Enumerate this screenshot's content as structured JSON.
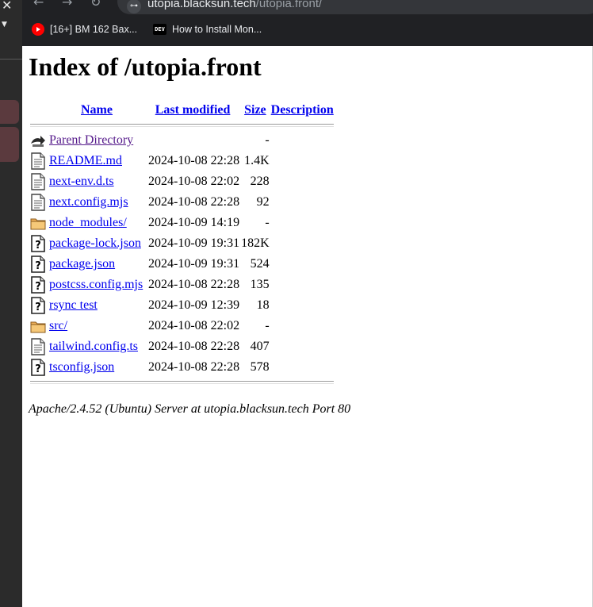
{
  "sidebar": {
    "close_glyph": "✕",
    "caret_glyph": "▼"
  },
  "browser": {
    "back_glyph": "←",
    "forward_glyph": "→",
    "reload_glyph": "↻",
    "site_info_glyph": "⊶",
    "url_host": "utopia.blacksun.tech",
    "url_path": "/utopia.front/",
    "bookmarks": [
      {
        "label": "[16+] BM 162 Bax...",
        "icon": "youtube-icon"
      },
      {
        "label": "How to Install Mon...",
        "icon": "dev-icon",
        "icon_text": "DEV"
      }
    ]
  },
  "page": {
    "title": "Index of /utopia.front",
    "columns": {
      "name": "Name",
      "last_modified": "Last modified",
      "size": "Size",
      "description": "Description"
    },
    "rows": [
      {
        "name": "Parent Directory",
        "modified": "",
        "size": "-",
        "icon": "back-icon"
      },
      {
        "name": "README.md",
        "modified": "2024-10-08 22:28",
        "size": "1.4K",
        "icon": "text-file-icon"
      },
      {
        "name": "next-env.d.ts",
        "modified": "2024-10-08 22:02",
        "size": "228",
        "icon": "text-file-icon"
      },
      {
        "name": "next.config.mjs",
        "modified": "2024-10-08 22:28",
        "size": "92",
        "icon": "text-file-icon"
      },
      {
        "name": "node_modules/",
        "modified": "2024-10-09 14:19",
        "size": "-",
        "icon": "folder-icon"
      },
      {
        "name": "package-lock.json",
        "modified": "2024-10-09 19:31",
        "size": "182K",
        "icon": "unknown-file-icon"
      },
      {
        "name": "package.json",
        "modified": "2024-10-09 19:31",
        "size": "524",
        "icon": "unknown-file-icon"
      },
      {
        "name": "postcss.config.mjs",
        "modified": "2024-10-08 22:28",
        "size": "135",
        "icon": "unknown-file-icon"
      },
      {
        "name": "rsync test",
        "modified": "2024-10-09 12:39",
        "size": "18",
        "icon": "unknown-file-icon"
      },
      {
        "name": "src/",
        "modified": "2024-10-08 22:02",
        "size": "-",
        "icon": "folder-icon"
      },
      {
        "name": "tailwind.config.ts",
        "modified": "2024-10-08 22:28",
        "size": "407",
        "icon": "text-file-icon"
      },
      {
        "name": "tsconfig.json",
        "modified": "2024-10-08 22:28",
        "size": "578",
        "icon": "unknown-file-icon"
      }
    ],
    "footer": "Apache/2.4.52 (Ubuntu) Server at utopia.blacksun.tech Port 80"
  },
  "colors": {
    "link": "#0000ee",
    "visited_link": "#551a8b",
    "chrome_bg": "#202124",
    "sidebar_bg": "#2b2b2b"
  }
}
